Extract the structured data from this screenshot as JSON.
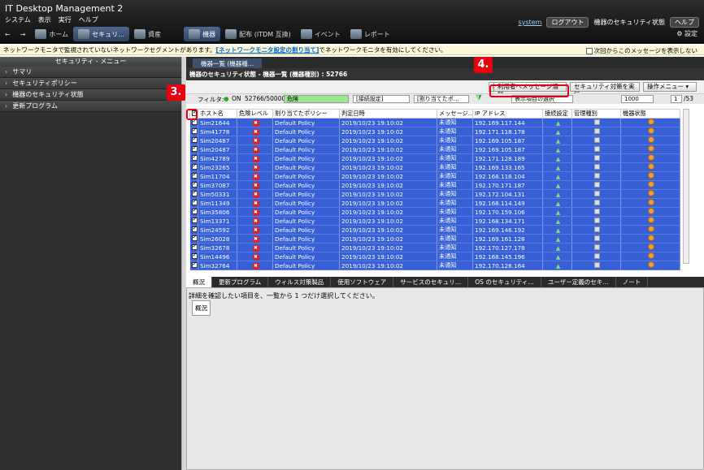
{
  "app": {
    "title": "IT Desktop Management 2",
    "menu": [
      "システム",
      "表示",
      "実行",
      "ヘルプ"
    ],
    "toolbar": [
      {
        "label": "ホーム",
        "icon": "home-icon"
      },
      {
        "label": "セキュリ…",
        "icon": "shield-icon",
        "active": true
      },
      {
        "label": "資産",
        "icon": "asset-icon"
      },
      {
        "label": "機器",
        "icon": "device-icon",
        "active": true
      },
      {
        "label": "配布 (ITDM 互換)",
        "icon": "distribute-icon"
      },
      {
        "label": "イベント",
        "icon": "event-icon"
      },
      {
        "label": "レポート",
        "icon": "report-icon"
      }
    ],
    "user": "system",
    "logout": "ログアウト",
    "security_status": "機器のセキュリティ状態",
    "help": "ヘルプ",
    "settings": "設定"
  },
  "notice": {
    "text_before": "ネットワークモニタで監視されていないネットワークセグメントがあります。",
    "link": "[ネットワークモニタ設定の割り当て]",
    "text_after": "でネットワークモニタを有効にしてください。",
    "dont_show": "次回からこのメッセージを表示しない"
  },
  "sidebar": {
    "title": "セキュリティ - メニュー",
    "items": [
      "サマリ",
      "セキュリティポリシー",
      "機器のセキュリティ状態",
      "更新プログラム"
    ]
  },
  "main": {
    "tab": "機器一覧 (機器種…",
    "breadcrumb": "機器のセキュリティ状態 - 機器一覧 (機器種別) : 52766",
    "buttons": {
      "notify": "利用者へメッセージ通知",
      "run_security": "セキュリティ対策を実行",
      "ops_menu": "操作メニュー"
    },
    "filter": {
      "label": "フィルタ:",
      "on": "ON",
      "count": "52766/50000",
      "risk": "危険",
      "conn": "[接続設定]",
      "assign": "[割り当てたポ…",
      "show_items": "表示項目の選択",
      "per_page": "1000",
      "page": "1",
      "total_pages": "/53"
    },
    "columns": [
      "",
      "ホスト名",
      "危険レベル",
      "割り当てたポリシー",
      "判定日時",
      "メッセージ…",
      "IP アドレス",
      "接続設定",
      "管理種別",
      "機器状態"
    ],
    "rows": [
      {
        "host": "Sim21644",
        "policy": "Default Policy",
        "date": "2019/10/23 19:10:02",
        "msg": "未通知",
        "ip": "192.169.117.144"
      },
      {
        "host": "Sim41778",
        "policy": "Default Policy",
        "date": "2019/10/23 19:10:02",
        "msg": "未通知",
        "ip": "192.171.118.178"
      },
      {
        "host": "Sim20487",
        "policy": "Default Policy",
        "date": "2019/10/23 19:10:02",
        "msg": "未通知",
        "ip": "192.169.105.187"
      },
      {
        "host": "Sim20487",
        "policy": "Default Policy",
        "date": "2019/10/23 19:10:02",
        "msg": "未通知",
        "ip": "192.169.105.187"
      },
      {
        "host": "Sim42789",
        "policy": "Default Policy",
        "date": "2019/10/23 19:10:02",
        "msg": "未通知",
        "ip": "192.171.128.189"
      },
      {
        "host": "Sim23265",
        "policy": "Default Policy",
        "date": "2019/10/23 19:10:02",
        "msg": "未通知",
        "ip": "192.169.133.165"
      },
      {
        "host": "Sim11704",
        "policy": "Default Policy",
        "date": "2019/10/23 19:10:02",
        "msg": "未通知",
        "ip": "192.168.118.104"
      },
      {
        "host": "Sim37087",
        "policy": "Default Policy",
        "date": "2019/10/23 19:10:02",
        "msg": "未通知",
        "ip": "192.170.171.187"
      },
      {
        "host": "Sim50331",
        "policy": "Default Policy",
        "date": "2019/10/23 19:10:02",
        "msg": "未通知",
        "ip": "192.172.104.131"
      },
      {
        "host": "Sim11349",
        "policy": "Default Policy",
        "date": "2019/10/23 19:10:02",
        "msg": "未通知",
        "ip": "192.168.114.149"
      },
      {
        "host": "Sim35806",
        "policy": "Default Policy",
        "date": "2019/10/23 19:10:02",
        "msg": "未通知",
        "ip": "192.170.159.106"
      },
      {
        "host": "Sim13371",
        "policy": "Default Policy",
        "date": "2019/10/23 19:10:02",
        "msg": "未通知",
        "ip": "192.168.134.171"
      },
      {
        "host": "Sim24592",
        "policy": "Default Policy",
        "date": "2019/10/23 19:10:02",
        "msg": "未通知",
        "ip": "192.169.146.192"
      },
      {
        "host": "Sim26028",
        "policy": "Default Policy",
        "date": "2019/10/23 19:10:02",
        "msg": "未通知",
        "ip": "192.169.161.128"
      },
      {
        "host": "Sim32678",
        "policy": "Default Policy",
        "date": "2019/10/23 19:10:02",
        "msg": "未通知",
        "ip": "192.170.127.178"
      },
      {
        "host": "Sim14496",
        "policy": "Default Policy",
        "date": "2019/10/23 19:10:02",
        "msg": "未通知",
        "ip": "192.168.145.196"
      },
      {
        "host": "Sim32764",
        "policy": "Default Policy",
        "date": "2019/10/23 19:10:02",
        "msg": "未通知",
        "ip": "192.170.128.164"
      }
    ]
  },
  "detail": {
    "tabs": [
      "概況",
      "更新プログラム",
      "ウィルス対策製品",
      "使用ソフトウェア",
      "サービスのセキュリ…",
      "OS のセキュリティ…",
      "ユーザー定義のセキ…",
      "ノート"
    ],
    "message": "詳細を確認したい項目を、一覧から 1 つだけ選択してください。",
    "tooltip": "概況"
  },
  "callouts": {
    "step3": "3.",
    "step4": "4."
  },
  "colors": {
    "selection": "#3760d7",
    "callout": "#e8000f",
    "notice_bg": "#fbf8d8"
  }
}
